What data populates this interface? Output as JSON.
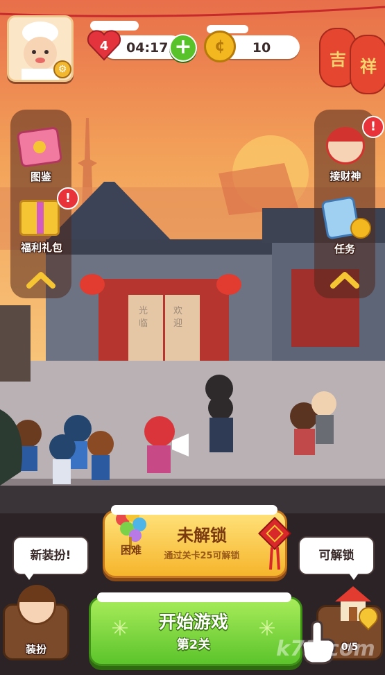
{
  "hud": {
    "lives": "4",
    "timer": "04:17",
    "coins": "10"
  },
  "left_menu": [
    {
      "label": "图鉴"
    },
    {
      "label": "福利礼包"
    }
  ],
  "right_menu": [
    {
      "label": "接财神"
    },
    {
      "label": "任务"
    }
  ],
  "lanterns": [
    "吉",
    "祥"
  ],
  "scene_text": {
    "door_left": "光临",
    "door_right": "欢迎"
  },
  "level_panel": {
    "difficulty": "困难",
    "title": "未解锁",
    "subtitle": "通过关卡25可解锁"
  },
  "start_button": {
    "title": "开始游戏",
    "level": "第2关"
  },
  "dress_up": {
    "bubble": "新装扮!",
    "label": "装扮"
  },
  "unlock": {
    "bubble": "可解锁",
    "progress": "0/5"
  },
  "watermark": "k73.com",
  "colors": {
    "accent_gold": "#f6c534",
    "alert_red": "#e8333a",
    "start_green": "#5cc42c",
    "locked_orange": "#f6b52c"
  }
}
